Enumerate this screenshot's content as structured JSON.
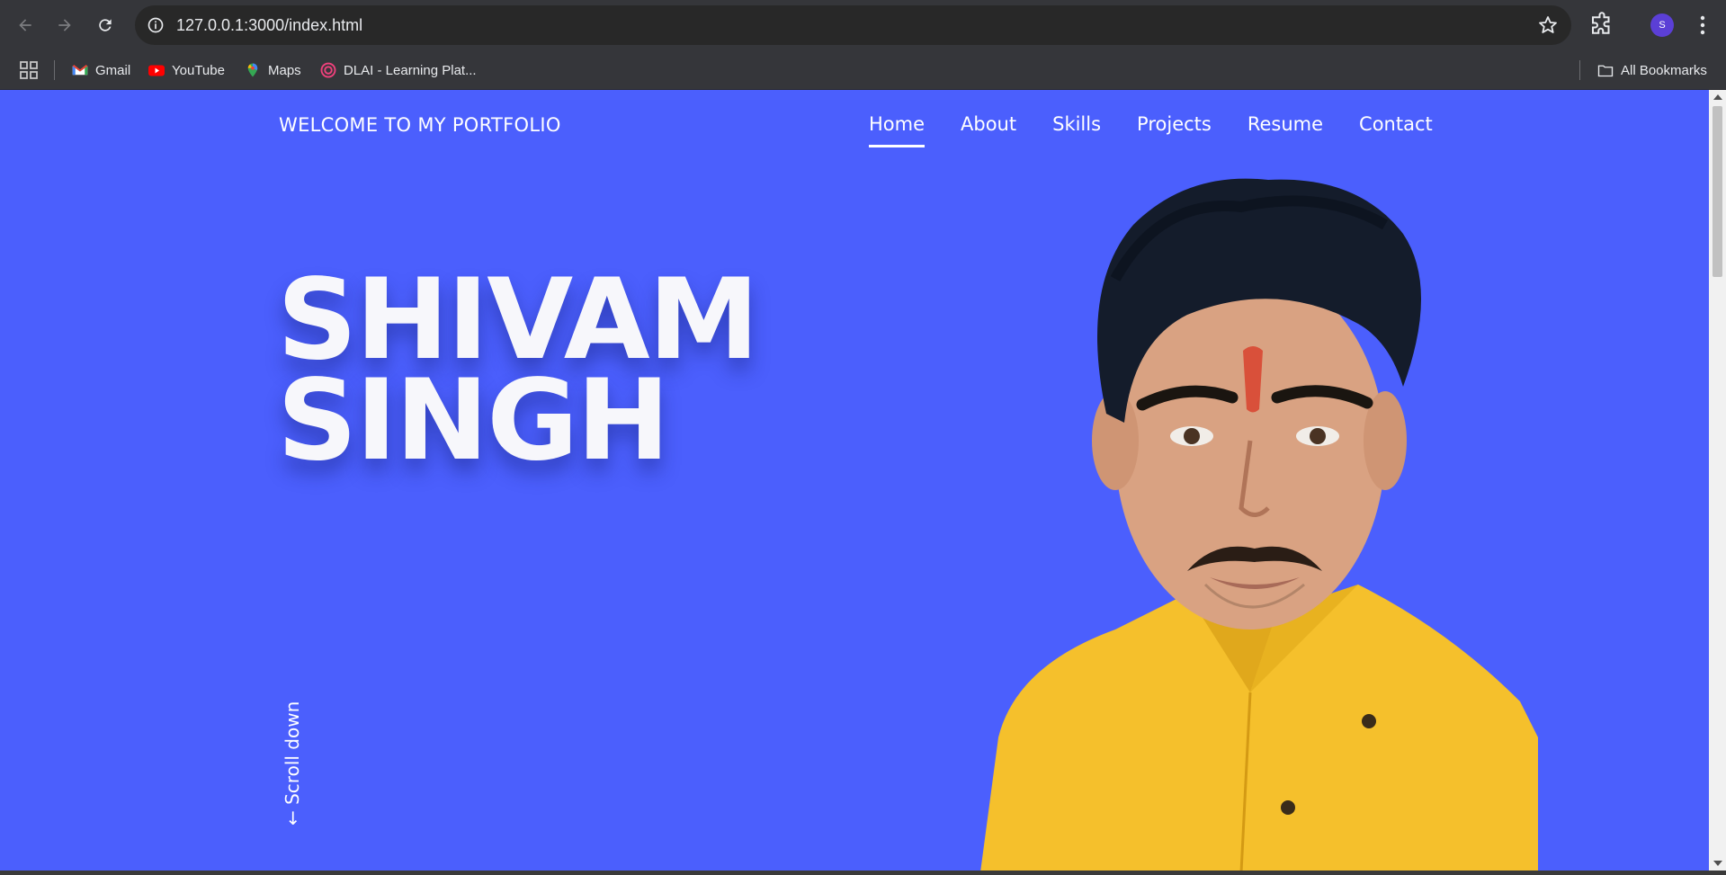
{
  "browser": {
    "url": "127.0.0.1:3000/index.html",
    "avatar_letter": "S",
    "icons": [
      "back-icon",
      "forward-icon",
      "reload-icon",
      "site-info-icon",
      "star-icon",
      "extensions-icon",
      "menu-icon"
    ]
  },
  "bookmarks": {
    "items": [
      {
        "label": "Gmail",
        "icon": "gmail-icon"
      },
      {
        "label": "YouTube",
        "icon": "youtube-icon"
      },
      {
        "label": "Maps",
        "icon": "maps-icon"
      },
      {
        "label": "DLAI - Learning Plat...",
        "icon": "dlai-icon"
      }
    ],
    "all_bookmarks": "All Bookmarks"
  },
  "page": {
    "brand": "WELCOME TO MY PORTFOLIO",
    "nav": [
      {
        "label": "Home",
        "active": true
      },
      {
        "label": "About",
        "active": false
      },
      {
        "label": "Skills",
        "active": false
      },
      {
        "label": "Projects",
        "active": false
      },
      {
        "label": "Resume",
        "active": false
      },
      {
        "label": "Contact",
        "active": false
      }
    ],
    "hero": {
      "first_name": "SHIVAM",
      "last_name": "SINGH"
    },
    "scroll_hint": "← Scroll down",
    "colors": {
      "background": "#4b5ffd",
      "text": "#ffffff",
      "shirt": "#f5c02c"
    }
  }
}
